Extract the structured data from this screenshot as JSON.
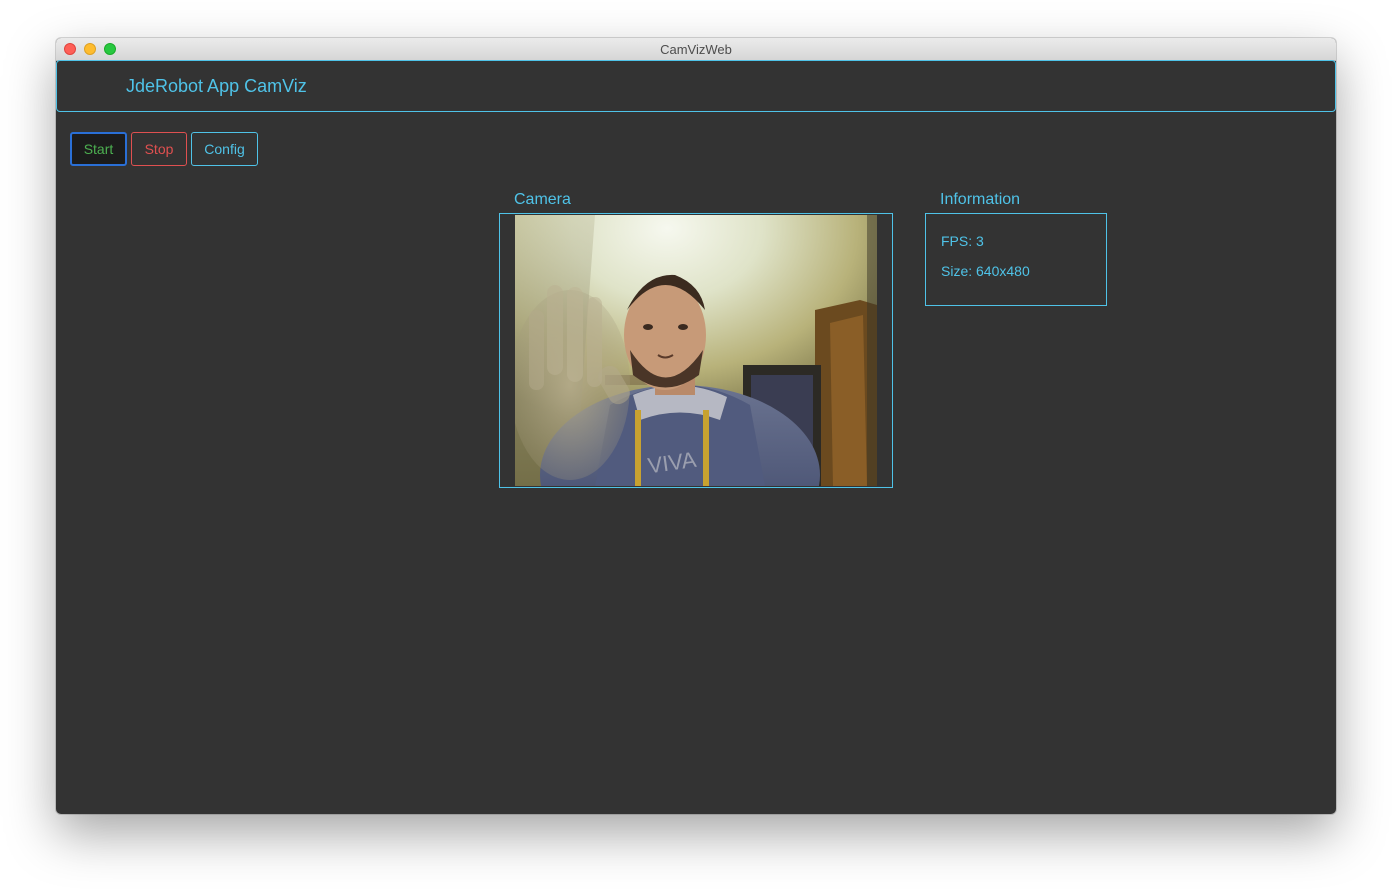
{
  "window": {
    "title": "CamVizWeb"
  },
  "header": {
    "app_title": "JdeRobot App CamViz"
  },
  "toolbar": {
    "start_label": "Start",
    "stop_label": "Stop",
    "config_label": "Config"
  },
  "camera": {
    "label": "Camera"
  },
  "information": {
    "label": "Information",
    "fps_text": "FPS: 3",
    "size_text": "Size: 640x480"
  },
  "colors": {
    "background": "#333333",
    "accent": "#4fc3e8",
    "start": "#4caf50",
    "stop": "#e05050",
    "focus_ring": "#2a6fd6"
  }
}
